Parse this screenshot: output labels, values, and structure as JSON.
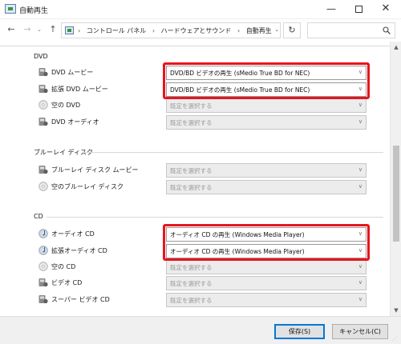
{
  "window": {
    "title": "自動再生",
    "minimize_glyph": "—",
    "close_glyph": "✕"
  },
  "address": {
    "breadcrumbs": [
      "コントロール パネル",
      "ハードウェアとサウンド",
      "自動再生"
    ],
    "search_placeholder": ""
  },
  "sections": {
    "dvd": {
      "heading": "DVD",
      "rows": [
        {
          "label": "DVD ムービー",
          "value": "DVD/BD ビデオの再生 (sMedio True BD for NEC)",
          "icon": "dvd-movie-icon"
        },
        {
          "label": "拡張 DVD ムービー",
          "value": "DVD/BD ビデオの再生 (sMedio True BD for NEC)",
          "icon": "dvd-movie-icon"
        },
        {
          "label": "空の DVD",
          "value": "既定を選択する",
          "icon": "blank-disc-icon"
        },
        {
          "label": "DVD オーディオ",
          "value": "既定を選択する",
          "icon": "dvd-audio-icon"
        }
      ]
    },
    "bluray": {
      "heading": "ブルーレイ ディスク",
      "rows": [
        {
          "label": "ブルーレイ ディスク ムービー",
          "value": "既定を選択する",
          "icon": "bluray-movie-icon"
        },
        {
          "label": "空のブルーレイ ディスク",
          "value": "既定を選択する",
          "icon": "blank-disc-icon"
        }
      ]
    },
    "cd": {
      "heading": "CD",
      "rows": [
        {
          "label": "オーディオ CD",
          "value": "オーディオ CD の再生 (Windows Media Player)",
          "icon": "audio-cd-icon"
        },
        {
          "label": "拡張オーディオ CD",
          "value": "オーディオ CD の再生 (Windows Media Player)",
          "icon": "audio-cd-icon"
        },
        {
          "label": "空の CD",
          "value": "既定を選択する",
          "icon": "blank-disc-icon"
        },
        {
          "label": "ビデオ CD",
          "value": "既定を選択する",
          "icon": "video-cd-icon"
        },
        {
          "label": "スーパー ビデオ CD",
          "value": "既定を選択する",
          "icon": "video-cd-icon"
        }
      ]
    }
  },
  "footer": {
    "save_label": "保存(S)",
    "cancel_label": "キャンセル(C)"
  },
  "colors": {
    "highlight": "#e8141e",
    "accent": "#0078d7"
  }
}
